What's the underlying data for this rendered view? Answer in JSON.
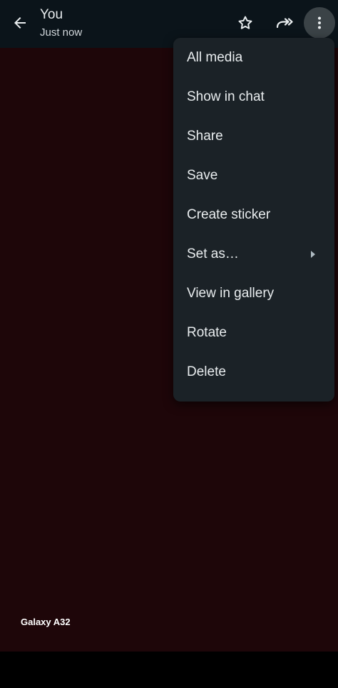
{
  "header": {
    "title": "You",
    "subtitle": "Just now"
  },
  "icons": {
    "back": "arrow-back-icon",
    "star": "star-outline-icon",
    "forward": "forward-icon",
    "more": "more-vertical-icon"
  },
  "menu": {
    "items": [
      {
        "label": "All media"
      },
      {
        "label": "Show in chat"
      },
      {
        "label": "Share"
      },
      {
        "label": "Save"
      },
      {
        "label": "Create sticker"
      },
      {
        "label": "Set as…",
        "has_submenu": true
      },
      {
        "label": "View in gallery"
      },
      {
        "label": "Rotate"
      },
      {
        "label": "Delete"
      }
    ]
  },
  "watermark": {
    "text": "Galaxy A32"
  },
  "colors": {
    "header_bg": "#0b141a",
    "menu_bg": "#1b2227",
    "text": "#e9edef",
    "media_tint": "#2a080e"
  }
}
